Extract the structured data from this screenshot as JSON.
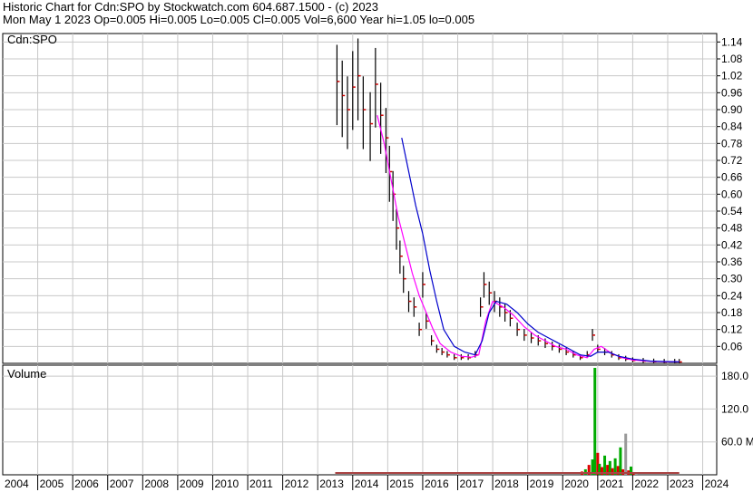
{
  "header": {
    "line1": "Historic Chart for Cdn:SPO by Stockwatch.com 604.687.1500 - (c) 2023",
    "line2": "Mon May  1 2023   Op=0.005  Hi=0.005  Lo=0.005  Cl=0.005  Vol=6,600   Year hi=1.05  lo=0.005"
  },
  "chart_data": [
    {
      "type": "line",
      "title": "Cdn:SPO",
      "ylim": [
        0,
        1.17
      ],
      "y_ticks": [
        "1.14",
        "1.08",
        "1.02",
        "0.96",
        "0.90",
        "0.84",
        "0.78",
        "0.72",
        "0.66",
        "0.60",
        "0.54",
        "0.48",
        "0.42",
        "0.36",
        "0.30",
        "0.24",
        "0.18",
        "0.12",
        "0.06"
      ],
      "x_ticks": [
        "2004",
        "2005",
        "2006",
        "2007",
        "2008",
        "2009",
        "2010",
        "2011",
        "2012",
        "2013",
        "2014",
        "2015",
        "2016",
        "2017",
        "2018",
        "2019",
        "2020",
        "2021",
        "2022",
        "2023",
        "2024"
      ],
      "grid": true,
      "colors": {
        "price": "#000000",
        "ma_short": "#ff00ff",
        "ma_long": "#0000cc",
        "close_tick": "#cc0000"
      },
      "series": [
        {
          "values_x": [
            2013.55,
            2013.7,
            2013.85,
            2014.0,
            2014.15,
            2014.3,
            2014.5,
            2014.65,
            2014.8,
            2014.95,
            2015.05,
            2015.15,
            2015.25,
            2015.35,
            2015.45,
            2015.6,
            2015.75,
            2015.9,
            2016.0,
            2016.1,
            2016.25,
            2016.4,
            2016.55,
            2016.7,
            2016.9,
            2017.1,
            2017.3,
            2017.5,
            2017.65,
            2017.75,
            2017.9,
            2018.05,
            2018.2,
            2018.35,
            2018.5,
            2018.7,
            2018.9,
            2019.1,
            2019.3,
            2019.5,
            2019.7,
            2019.9,
            2020.1,
            2020.3,
            2020.5,
            2020.7,
            2020.85,
            2021.0,
            2021.2,
            2021.4,
            2021.6,
            2021.8,
            2022.0,
            2022.3,
            2022.6,
            2022.9,
            2023.2,
            2023.33
          ],
          "values_y": [
            1.0,
            0.95,
            0.9,
            0.98,
            1.02,
            0.9,
            0.85,
            0.99,
            0.88,
            0.8,
            0.68,
            0.6,
            0.48,
            0.38,
            0.3,
            0.22,
            0.2,
            0.12,
            0.28,
            0.15,
            0.08,
            0.05,
            0.04,
            0.03,
            0.02,
            0.02,
            0.02,
            0.03,
            0.2,
            0.28,
            0.25,
            0.22,
            0.2,
            0.18,
            0.16,
            0.12,
            0.1,
            0.09,
            0.08,
            0.07,
            0.06,
            0.05,
            0.04,
            0.03,
            0.02,
            0.03,
            0.1,
            0.05,
            0.04,
            0.03,
            0.02,
            0.015,
            0.01,
            0.008,
            0.006,
            0.005,
            0.005,
            0.005
          ]
        },
        {
          "values_x": [
            2014.7,
            2014.9,
            2015.1,
            2015.3,
            2015.5,
            2015.7,
            2015.9,
            2016.1,
            2016.3,
            2016.5,
            2016.8,
            2017.1,
            2017.4,
            2017.6,
            2017.8,
            2018.0,
            2018.3,
            2018.6,
            2018.9,
            2019.2,
            2019.5,
            2019.8,
            2020.1,
            2020.4,
            2020.7,
            2020.9,
            2021.1,
            2021.4,
            2021.7,
            2022.0,
            2022.5,
            2023.0,
            2023.33
          ],
          "values_y": [
            0.88,
            0.78,
            0.65,
            0.52,
            0.42,
            0.32,
            0.24,
            0.18,
            0.12,
            0.07,
            0.04,
            0.025,
            0.022,
            0.03,
            0.15,
            0.22,
            0.2,
            0.17,
            0.13,
            0.1,
            0.08,
            0.06,
            0.05,
            0.03,
            0.02,
            0.05,
            0.06,
            0.035,
            0.02,
            0.012,
            0.007,
            0.005,
            0.005
          ],
          "name": ""
        },
        {
          "values_x": [
            2015.4,
            2015.6,
            2015.8,
            2016.0,
            2016.2,
            2016.4,
            2016.6,
            2016.9,
            2017.2,
            2017.5,
            2017.7,
            2017.9,
            2018.1,
            2018.4,
            2018.7,
            2019.0,
            2019.3,
            2019.6,
            2019.9,
            2020.2,
            2020.5,
            2020.8,
            2021.0,
            2021.3,
            2021.6,
            2022.0,
            2022.5,
            2023.0,
            2023.33
          ],
          "values_y": [
            0.8,
            0.68,
            0.56,
            0.46,
            0.33,
            0.22,
            0.12,
            0.06,
            0.04,
            0.03,
            0.08,
            0.18,
            0.22,
            0.21,
            0.18,
            0.14,
            0.11,
            0.09,
            0.07,
            0.05,
            0.03,
            0.025,
            0.04,
            0.04,
            0.025,
            0.015,
            0.008,
            0.006,
            0.005
          ],
          "name": ""
        }
      ]
    },
    {
      "type": "bar",
      "title": "Volume",
      "ylim": [
        0,
        200
      ],
      "y_ticks": [
        "180.0",
        "120.0",
        "60.0 M"
      ],
      "colors": {
        "up": "#00aa00",
        "down": "#dd0000",
        "flat": "#999999"
      },
      "x": [
        2020.55,
        2020.65,
        2020.75,
        2020.85,
        2020.92,
        2021.0,
        2021.05,
        2021.12,
        2021.2,
        2021.28,
        2021.35,
        2021.42,
        2021.5,
        2021.58,
        2021.65,
        2021.72,
        2021.8,
        2021.88,
        2021.95,
        2022.02,
        2022.1
      ],
      "values": [
        6,
        10,
        18,
        28,
        195,
        40,
        20,
        14,
        35,
        18,
        25,
        12,
        30,
        16,
        50,
        10,
        75,
        8,
        15,
        5,
        3
      ],
      "colors_by_bar": [
        "down",
        "up",
        "down",
        "up",
        "up",
        "down",
        "up",
        "down",
        "up",
        "down",
        "up",
        "down",
        "up",
        "down",
        "up",
        "down",
        "flat",
        "down",
        "up",
        "down",
        "flat"
      ]
    }
  ]
}
